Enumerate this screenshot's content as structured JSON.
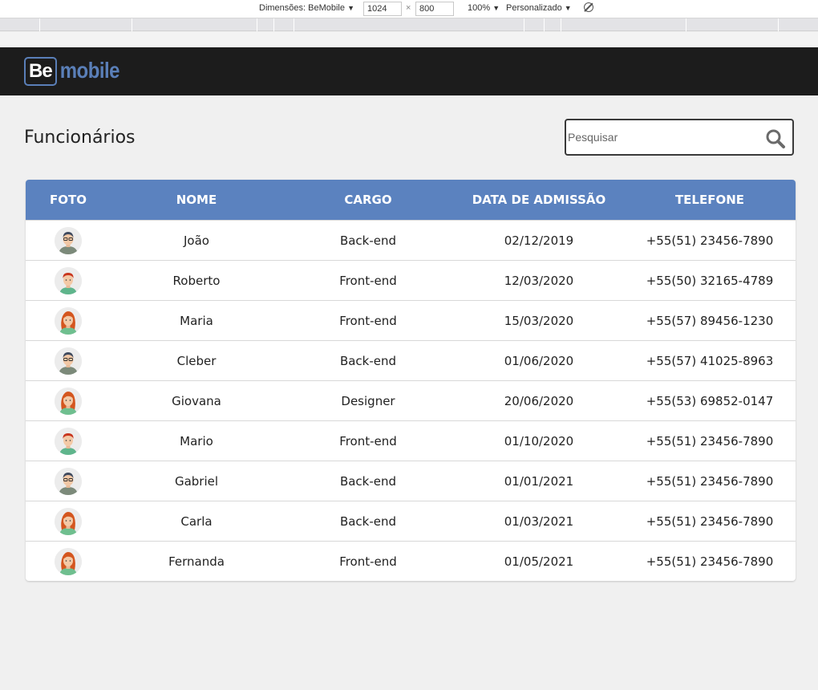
{
  "devtools": {
    "dimensions_label": "Dimensões: BeMobile",
    "width": "1024",
    "times": "×",
    "height": "800",
    "zoom": "100%",
    "throttle": "Personalizado",
    "caret": "▼"
  },
  "header": {
    "logo_be": "Be",
    "logo_mobile": "mobile",
    "brand_color": "#5a7fb8"
  },
  "page": {
    "title": "Funcionários",
    "search_placeholder": "Pesquisar"
  },
  "table": {
    "header_color": "#5b82bf",
    "columns": [
      "FOTO",
      "NOME",
      "CARGO",
      "DATA DE ADMISSÃO",
      "TELEFONE"
    ],
    "rows": [
      {
        "avatar": "man-glasses",
        "nome": "João",
        "cargo": "Back-end",
        "data": "02/12/2019",
        "telefone": "+55(51) 23456-7890"
      },
      {
        "avatar": "boy-redhair",
        "nome": "Roberto",
        "cargo": "Front-end",
        "data": "12/03/2020",
        "telefone": "+55(50) 32165-4789"
      },
      {
        "avatar": "woman-redhair",
        "nome": "Maria",
        "cargo": "Front-end",
        "data": "15/03/2020",
        "telefone": "+55(57) 89456-1230"
      },
      {
        "avatar": "man-glasses",
        "nome": "Cleber",
        "cargo": "Back-end",
        "data": "01/06/2020",
        "telefone": "+55(57) 41025-8963"
      },
      {
        "avatar": "woman-redhair",
        "nome": "Giovana",
        "cargo": "Designer",
        "data": "20/06/2020",
        "telefone": "+55(53) 69852-0147"
      },
      {
        "avatar": "boy-redhair",
        "nome": "Mario",
        "cargo": "Front-end",
        "data": "01/10/2020",
        "telefone": "+55(51) 23456-7890"
      },
      {
        "avatar": "man-glasses",
        "nome": "Gabriel",
        "cargo": "Back-end",
        "data": "01/01/2021",
        "telefone": "+55(51) 23456-7890"
      },
      {
        "avatar": "woman-redhair",
        "nome": "Carla",
        "cargo": "Back-end",
        "data": "01/03/2021",
        "telefone": "+55(51) 23456-7890"
      },
      {
        "avatar": "woman-redhair",
        "nome": "Fernanda",
        "cargo": "Front-end",
        "data": "01/05/2021",
        "telefone": "+55(51) 23456-7890"
      }
    ]
  }
}
